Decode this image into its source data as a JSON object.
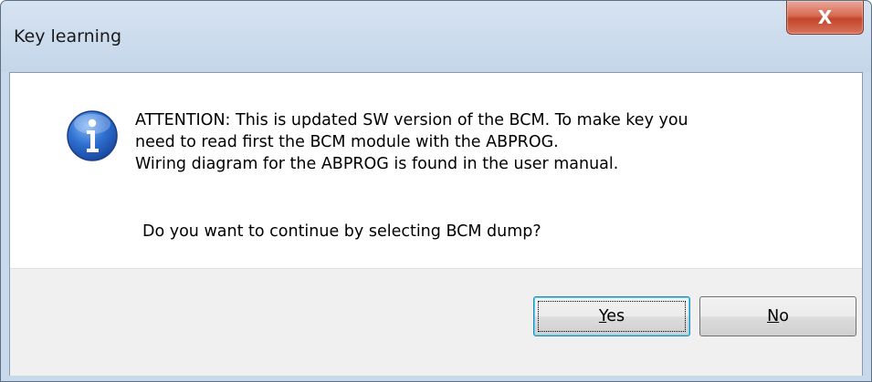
{
  "window": {
    "title": "Key learning",
    "close_glyph": "X"
  },
  "message": {
    "icon": "info-icon",
    "line1": "ATTENTION: This is updated SW version of the BCM. To make key you",
    "line2": "need to read first the BCM module with the ABPROG.",
    "line3": "Wiring diagram for the ABPROG is found in the user manual.",
    "question": "Do you want to continue by selecting BCM dump?"
  },
  "buttons": {
    "yes": {
      "mnemonic": "Y",
      "rest": "es"
    },
    "no": {
      "mnemonic": "N",
      "rest": "o"
    }
  },
  "colors": {
    "close_button": "#d86a52",
    "title_bar": "#c9d9ec",
    "footer": "#f0f0f0"
  }
}
